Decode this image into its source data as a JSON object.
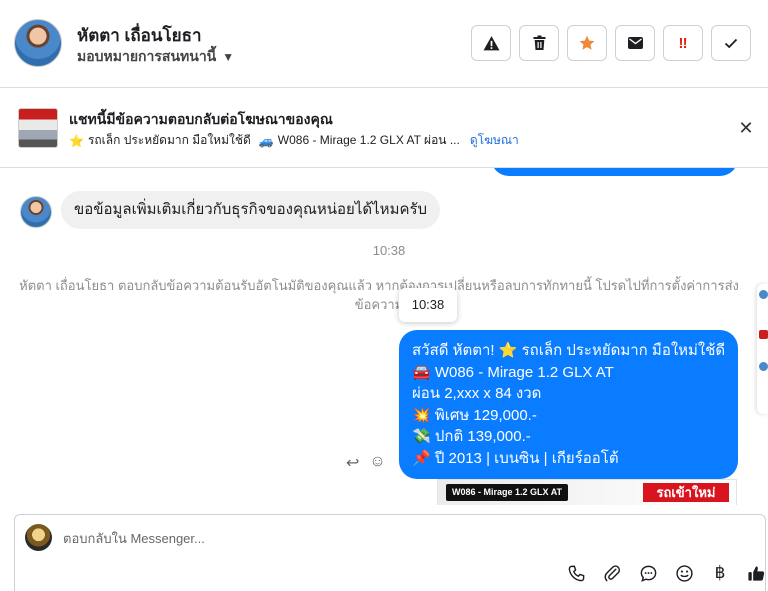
{
  "header": {
    "name": "หัตตา เถื่อนโยธา",
    "assign_label": "มอบหมายการสนทนานี้",
    "actions": [
      {
        "icon": "warning-icon"
      },
      {
        "icon": "trash-icon"
      },
      {
        "icon": "star-icon"
      },
      {
        "icon": "envelope-icon"
      },
      {
        "icon": "urgent-icon"
      },
      {
        "icon": "check-icon"
      }
    ]
  },
  "banner": {
    "title": "แชทนี้มีข้อความตอบกลับต่อโฆษณาของคุณ",
    "ad_text": "รถเล็ก ประหยัดมาก มือใหม่ใช้ดี",
    "ad_code": "W086 - Mirage 1.2 GLX AT ผ่อน ...",
    "link": "ดูโฆษณา"
  },
  "chat": {
    "incoming_message": "ขอข้อมูลเพิ่มเติมเกี่ยวกับธุรกิจของคุณหน่อยได้ไหมครับ",
    "time": "10:38",
    "system_note": "หัตตา เถื่อนโยธา ตอบกลับข้อความต้อนรับอัตโนมัติของคุณแล้ว หากต้องการเปลี่ยนหรือลบการทักทายนี้ โปรดไปที่การตั้งค่าการส่งข้อความ",
    "tooltip_time": "10:38",
    "outgoing_lines": [
      "สวัสดี หัตตา! ⭐ รถเล็ก ประหยัดมาก มือใหม่ใช้ดี",
      "🚘 W086 - Mirage 1.2 GLX AT",
      "ผ่อน 2,xxx x 84 งวด",
      "💥 พิเศษ 129,000.-",
      "💸 ปกติ 139,000.-",
      "📌 ปี 2013 | เบนซิน | เกียร์ออโต้"
    ],
    "image_tag": "W086 - Mirage 1.2 GLX AT",
    "image_badge": "รถเข้าใหม่"
  },
  "composer": {
    "placeholder": "ตอบกลับใน Messenger...",
    "tools": [
      "phone-icon",
      "attach-icon",
      "chat-bubble-icon",
      "emoji-icon",
      "baht-icon",
      "thumbs-up-icon"
    ]
  }
}
